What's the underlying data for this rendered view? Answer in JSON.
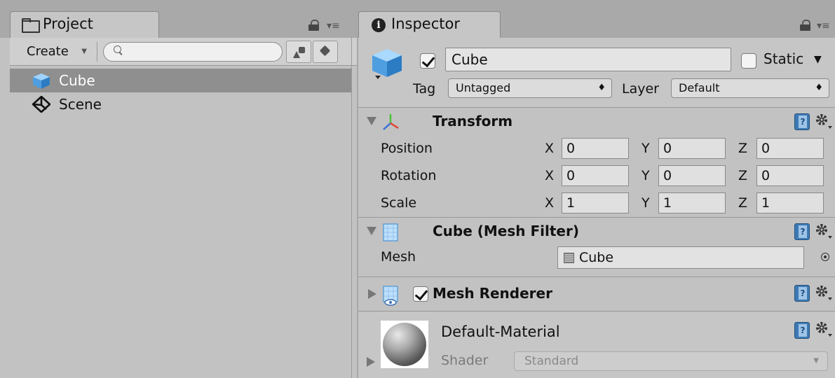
{
  "project": {
    "tab_title": "Project",
    "toolbar": {
      "create_label": "Create",
      "search_placeholder": ""
    },
    "items": [
      {
        "label": "Cube",
        "icon": "cube-icon",
        "selected": true
      },
      {
        "label": "Scene",
        "icon": "unity-scene-icon",
        "selected": false
      }
    ]
  },
  "inspector": {
    "tab_title": "Inspector",
    "gameobject": {
      "name": "Cube",
      "active": true,
      "static_label": "Static",
      "static": false,
      "tag_label": "Tag",
      "tag_value": "Untagged",
      "layer_label": "Layer",
      "layer_value": "Default"
    },
    "transform": {
      "title": "Transform",
      "rows": [
        {
          "label": "Position",
          "x": "0",
          "y": "0",
          "z": "0"
        },
        {
          "label": "Rotation",
          "x": "0",
          "y": "0",
          "z": "0"
        },
        {
          "label": "Scale",
          "x": "1",
          "y": "1",
          "z": "1"
        }
      ],
      "axes": {
        "x": "X",
        "y": "Y",
        "z": "Z"
      }
    },
    "mesh_filter": {
      "title": "Cube (Mesh Filter)",
      "mesh_label": "Mesh",
      "mesh_value": "Cube"
    },
    "mesh_renderer": {
      "title": "Mesh Renderer",
      "enabled": true
    },
    "material": {
      "name": "Default-Material",
      "shader_label": "Shader",
      "shader_value": "Standard"
    }
  },
  "colors": {
    "selection": "#8f8f8f",
    "panel": "#c2c2c2",
    "cube_blue": "#5aa9e6"
  }
}
